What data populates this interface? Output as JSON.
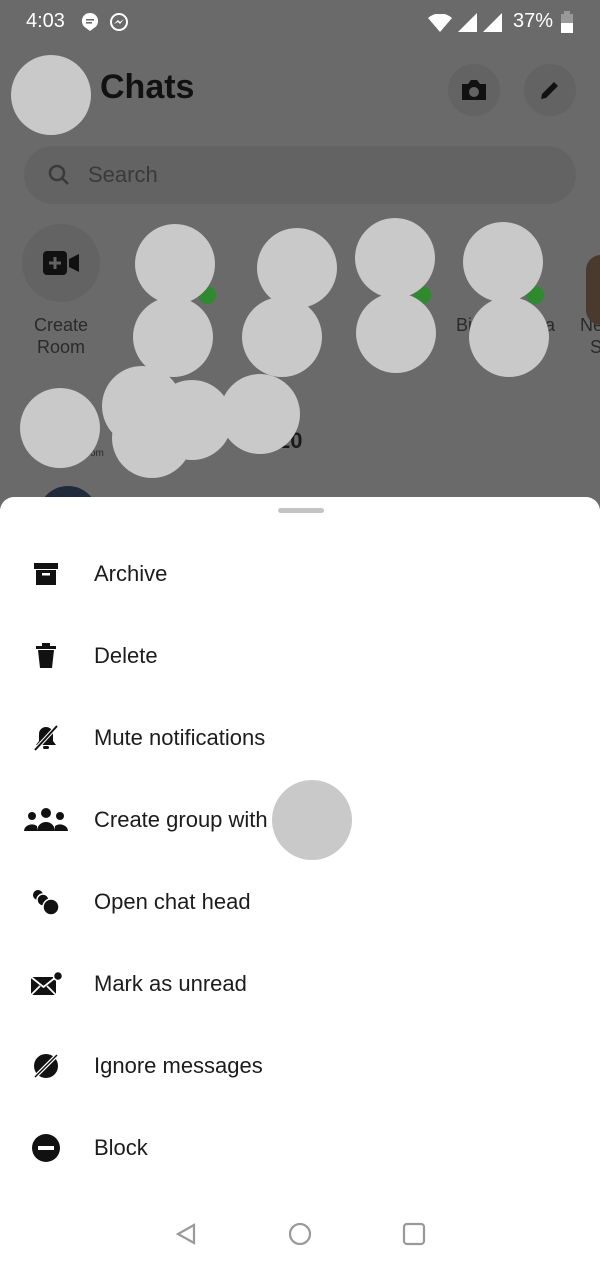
{
  "status_bar": {
    "time": "4:03",
    "battery": "37%",
    "icons": [
      "chat-notification-icon",
      "messenger-icon",
      "wifi-icon",
      "signal-icon",
      "signal-icon",
      "battery-icon"
    ]
  },
  "header": {
    "title": "Chats",
    "camera_icon": "camera-icon",
    "compose_icon": "pencil-icon"
  },
  "search": {
    "placeholder": "Search"
  },
  "stories": {
    "create_room": "Create\nRoom",
    "partial_labels": [
      "Bi",
      "a",
      "Ne",
      "S"
    ]
  },
  "chat_row": {
    "partial_text": "20",
    "time_partial": "om"
  },
  "sheet": {
    "items": [
      {
        "label": "Archive",
        "icon": "archive-icon"
      },
      {
        "label": "Delete",
        "icon": "trash-icon"
      },
      {
        "label": "Mute notifications",
        "icon": "bell-off-icon"
      },
      {
        "label": "Create group with",
        "icon": "group-icon"
      },
      {
        "label": "Open chat head",
        "icon": "chat-heads-icon"
      },
      {
        "label": "Mark as unread",
        "icon": "mail-unread-icon"
      },
      {
        "label": "Ignore messages",
        "icon": "ignore-icon"
      },
      {
        "label": "Block",
        "icon": "block-icon"
      }
    ]
  },
  "nav": {
    "icons": [
      "back-icon",
      "home-icon",
      "recents-icon"
    ]
  },
  "colors": {
    "overlay": "#6a6a6a",
    "online": "#2f8a2f",
    "sheet": "#ffffff"
  }
}
